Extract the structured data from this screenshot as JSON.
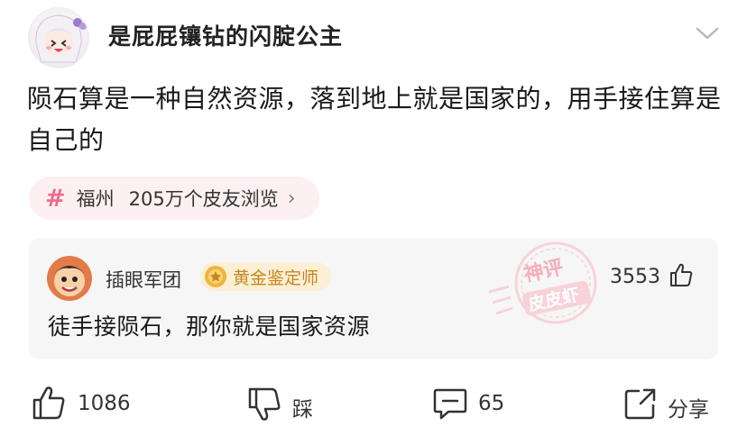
{
  "post": {
    "author": "是屁屁镶钻的闪腚公主",
    "text": "陨石算是一种自然资源，落到地上就是国家的，用手接住算是自己的"
  },
  "topic": {
    "name": "福州",
    "views": "205万个皮友浏览",
    "arrow": "›"
  },
  "comment": {
    "author": "插眼军团",
    "badge": "黄金鉴定师",
    "likes": "3553",
    "text": "徒手接陨石，那你就是国家资源"
  },
  "watermark": {
    "top": "神评",
    "bottom": "皮皮虾"
  },
  "actions": {
    "like_count": "1086",
    "dislike_label": "踩",
    "comment_count": "65",
    "share_label": "分享"
  },
  "icons": [
    "avatar",
    "chevron-down-icon",
    "hash-icon",
    "badge-medal-icon",
    "thumbs-up-icon",
    "thumbs-down-icon",
    "comment-icon",
    "share-icon"
  ],
  "colors": {
    "accent_pink": "#f06c8a",
    "topic_bg": "#fdf0f2",
    "badge_bg": "#fbf0d6",
    "badge_text": "#c8861d",
    "card_bg": "#f6f6f6"
  }
}
